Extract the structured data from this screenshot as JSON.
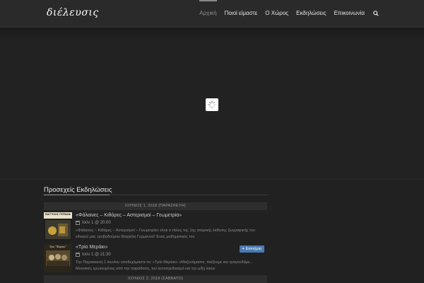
{
  "header": {
    "logo": "διέλευσις",
    "nav": [
      {
        "label": "Αρχική",
        "active": true
      },
      {
        "label": "Ποιοί είμαστε",
        "active": false
      },
      {
        "label": "Ο Χώρος",
        "active": false
      },
      {
        "label": "Εκδηλώσεις",
        "active": false
      },
      {
        "label": "Επικοινωνία",
        "active": false
      }
    ],
    "search_icon": "search-icon"
  },
  "hero": {
    "loader_icon": "spinner-icon"
  },
  "events_section": {
    "title": "Προσεχείς Εκδηλώσεις",
    "days": [
      {
        "date": "ΙΟΥΝΙΟΣ 1, 2018 (ΠΑΡΑΣΚΕΥΗ)",
        "events": [
          {
            "title": "«Φάλαινες – Κιθάρες – Αστερισμοί – Γεωμετρία»",
            "when": "Ιούν 1 @ 20:00",
            "description": "«Φάλαινες – Κιθάρες – Αστερισμοί – Γεωμετρία» είναι ο τίτλος της 1ης ατομικής έκθεσης ζωγραφικής του εθνικού μας τροβαδούρου Βαγγέλη Γερμανού! Ένας μαθηματικός του",
            "thumb_text": "ΒΑΓΓΕΛΗΣ ΓΕΡΜΑΝΟΣ"
          },
          {
            "title": "«Τρίο Μεράκι»",
            "when": "Ιούν 1 @ 21:30",
            "description": "Την Παρασκευή 1 Ιουνίου υποδεχόμαστε το: «Τρίο Μεράκι» «Μαζευόμαστε, παίζουμε και τραγουδάμε... Μουσικές ερωτευμένες από την παράδοση, τον αυτοσχεδιασμό και την μίξη λαών",
            "ticket_label": "Εισιτήρια",
            "thumb_text": "Τρίο \"Μεράκι\""
          }
        ]
      },
      {
        "date": "ΙΟΥΝΙΟΣ 2, 2018 (ΣΑΒΒΑΤΟ)",
        "events": []
      }
    ]
  }
}
